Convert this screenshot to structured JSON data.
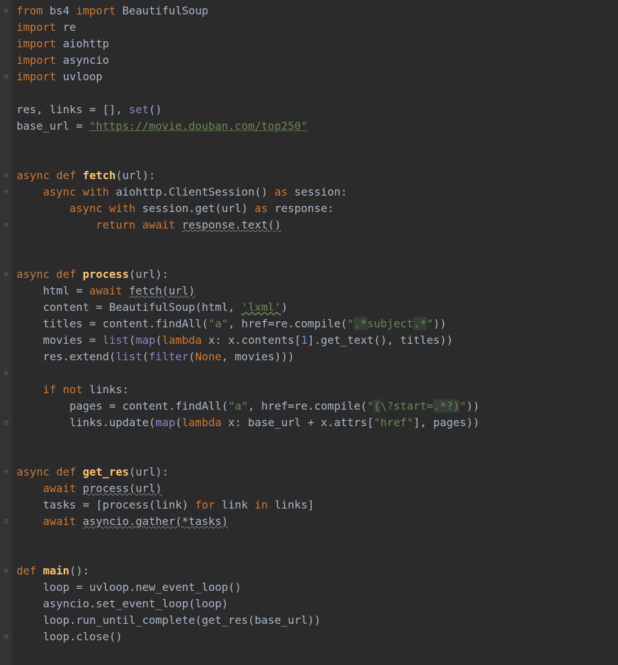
{
  "code": {
    "lines": [
      {
        "tokens": [
          {
            "t": "from ",
            "c": "kw"
          },
          {
            "t": "bs4 ",
            "c": "id"
          },
          {
            "t": "import ",
            "c": "kw"
          },
          {
            "t": "BeautifulSoup",
            "c": "id"
          }
        ],
        "gutter": "⊖"
      },
      {
        "tokens": [
          {
            "t": "import ",
            "c": "kw"
          },
          {
            "t": "re",
            "c": "id"
          }
        ],
        "gutter": ""
      },
      {
        "tokens": [
          {
            "t": "import ",
            "c": "kw"
          },
          {
            "t": "aiohttp",
            "c": "id"
          }
        ],
        "gutter": ""
      },
      {
        "tokens": [
          {
            "t": "import ",
            "c": "kw"
          },
          {
            "t": "asyncio",
            "c": "id"
          }
        ],
        "gutter": ""
      },
      {
        "tokens": [
          {
            "t": "import ",
            "c": "kw"
          },
          {
            "t": "uvloop",
            "c": "id"
          }
        ],
        "gutter": "⊟"
      },
      {
        "tokens": [
          {
            "t": "",
            "c": "id"
          }
        ],
        "gutter": ""
      },
      {
        "tokens": [
          {
            "t": "res, links = [], ",
            "c": "id"
          },
          {
            "t": "set",
            "c": "builtin"
          },
          {
            "t": "()",
            "c": "id"
          }
        ],
        "gutter": ""
      },
      {
        "tokens": [
          {
            "t": "base_url = ",
            "c": "id"
          },
          {
            "t": "\"https://movie.douban.com/top250\"",
            "c": "strhref"
          }
        ],
        "gutter": ""
      },
      {
        "tokens": [
          {
            "t": "",
            "c": "id"
          }
        ],
        "gutter": ""
      },
      {
        "tokens": [
          {
            "t": "",
            "c": "id"
          }
        ],
        "gutter": ""
      },
      {
        "tokens": [
          {
            "t": "async def ",
            "c": "kw"
          },
          {
            "t": "fetch",
            "c": "fn"
          },
          {
            "t": "(url):",
            "c": "id"
          }
        ],
        "gutter": "⊖"
      },
      {
        "tokens": [
          {
            "t": "    ",
            "c": "id"
          },
          {
            "t": "async with ",
            "c": "kw"
          },
          {
            "t": "aiohttp.ClientSession() ",
            "c": "id"
          },
          {
            "t": "as ",
            "c": "kw"
          },
          {
            "t": "session:",
            "c": "id"
          }
        ],
        "gutter": "⊖"
      },
      {
        "tokens": [
          {
            "t": "        ",
            "c": "id"
          },
          {
            "t": "async with ",
            "c": "kw"
          },
          {
            "t": "session.get(url) ",
            "c": "id"
          },
          {
            "t": "as ",
            "c": "kw"
          },
          {
            "t": "response:",
            "c": "id"
          }
        ],
        "gutter": ""
      },
      {
        "tokens": [
          {
            "t": "            ",
            "c": "id"
          },
          {
            "t": "return await ",
            "c": "kw"
          },
          {
            "t": "response.text()",
            "c": "id wavy"
          }
        ],
        "gutter": "⊟"
      },
      {
        "tokens": [
          {
            "t": "",
            "c": "id"
          }
        ],
        "gutter": ""
      },
      {
        "tokens": [
          {
            "t": "",
            "c": "id"
          }
        ],
        "gutter": ""
      },
      {
        "tokens": [
          {
            "t": "async def ",
            "c": "kw"
          },
          {
            "t": "process",
            "c": "fn"
          },
          {
            "t": "(url):",
            "c": "id"
          }
        ],
        "gutter": "⊖"
      },
      {
        "tokens": [
          {
            "t": "    html = ",
            "c": "id"
          },
          {
            "t": "await ",
            "c": "kw"
          },
          {
            "t": "fetch(url)",
            "c": "id wavy"
          }
        ],
        "gutter": ""
      },
      {
        "tokens": [
          {
            "t": "    content = BeautifulSoup(html, ",
            "c": "id"
          },
          {
            "t": "'lxml'",
            "c": "str wavyg"
          },
          {
            "t": ")",
            "c": "id"
          }
        ],
        "gutter": ""
      },
      {
        "tokens": [
          {
            "t": "    titles = content.findAll(",
            "c": "id"
          },
          {
            "t": "\"a\"",
            "c": "str"
          },
          {
            "t": ", ",
            "c": "id"
          },
          {
            "t": "href",
            "c": "id"
          },
          {
            "t": "=re.compile(",
            "c": "id"
          },
          {
            "t": "\"",
            "c": "str"
          },
          {
            "t": ".*",
            "c": "str hl"
          },
          {
            "t": "subject",
            "c": "str"
          },
          {
            "t": ".*",
            "c": "str hl"
          },
          {
            "t": "\"",
            "c": "str"
          },
          {
            "t": "))",
            "c": "id"
          }
        ],
        "gutter": ""
      },
      {
        "tokens": [
          {
            "t": "    movies = ",
            "c": "id"
          },
          {
            "t": "list",
            "c": "builtin"
          },
          {
            "t": "(",
            "c": "id"
          },
          {
            "t": "map",
            "c": "builtin"
          },
          {
            "t": "(",
            "c": "id"
          },
          {
            "t": "lambda ",
            "c": "kw"
          },
          {
            "t": "x: x.contents[",
            "c": "id"
          },
          {
            "t": "1",
            "c": "num"
          },
          {
            "t": "].get_text(), titles))",
            "c": "id"
          }
        ],
        "gutter": ""
      },
      {
        "tokens": [
          {
            "t": "    res.extend(",
            "c": "id"
          },
          {
            "t": "list",
            "c": "builtin"
          },
          {
            "t": "(",
            "c": "id"
          },
          {
            "t": "filter",
            "c": "builtin"
          },
          {
            "t": "(",
            "c": "id"
          },
          {
            "t": "None",
            "c": "kw"
          },
          {
            "t": ", movies)))",
            "c": "id"
          }
        ],
        "gutter": ""
      },
      {
        "tokens": [
          {
            "t": "",
            "c": "id"
          }
        ],
        "gutter": "⊖"
      },
      {
        "tokens": [
          {
            "t": "    ",
            "c": "id"
          },
          {
            "t": "if not ",
            "c": "kw"
          },
          {
            "t": "links:",
            "c": "id"
          }
        ],
        "gutter": ""
      },
      {
        "tokens": [
          {
            "t": "        pages = content.findAll(",
            "c": "id"
          },
          {
            "t": "\"a\"",
            "c": "str"
          },
          {
            "t": ", ",
            "c": "id"
          },
          {
            "t": "href",
            "c": "id"
          },
          {
            "t": "=re.compile(",
            "c": "id"
          },
          {
            "t": "\"",
            "c": "str"
          },
          {
            "t": "(",
            "c": "str hl"
          },
          {
            "t": "\\?start=",
            "c": "str"
          },
          {
            "t": ".*?)",
            "c": "str hl"
          },
          {
            "t": "\"",
            "c": "str"
          },
          {
            "t": "))",
            "c": "id"
          }
        ],
        "gutter": ""
      },
      {
        "tokens": [
          {
            "t": "        links.update(",
            "c": "id"
          },
          {
            "t": "map",
            "c": "builtin"
          },
          {
            "t": "(",
            "c": "id"
          },
          {
            "t": "lambda ",
            "c": "kw"
          },
          {
            "t": "x: base_url + x.attrs[",
            "c": "id"
          },
          {
            "t": "\"href\"",
            "c": "str"
          },
          {
            "t": "], pages))",
            "c": "id"
          }
        ],
        "gutter": "⊟"
      },
      {
        "tokens": [
          {
            "t": "",
            "c": "id"
          }
        ],
        "gutter": ""
      },
      {
        "tokens": [
          {
            "t": "",
            "c": "id"
          }
        ],
        "gutter": ""
      },
      {
        "tokens": [
          {
            "t": "async def ",
            "c": "kw"
          },
          {
            "t": "get_res",
            "c": "fn"
          },
          {
            "t": "(url):",
            "c": "id"
          }
        ],
        "gutter": "⊖"
      },
      {
        "tokens": [
          {
            "t": "    ",
            "c": "id"
          },
          {
            "t": "await ",
            "c": "kw"
          },
          {
            "t": "process(url)",
            "c": "id wavy"
          }
        ],
        "gutter": ""
      },
      {
        "tokens": [
          {
            "t": "    tasks = [process(link) ",
            "c": "id"
          },
          {
            "t": "for ",
            "c": "kw"
          },
          {
            "t": "link ",
            "c": "id"
          },
          {
            "t": "in ",
            "c": "kw"
          },
          {
            "t": "links]",
            "c": "id"
          }
        ],
        "gutter": ""
      },
      {
        "tokens": [
          {
            "t": "    ",
            "c": "id"
          },
          {
            "t": "await ",
            "c": "kw"
          },
          {
            "t": "asyncio.gather(*tasks)",
            "c": "id wavy"
          }
        ],
        "gutter": "⊟"
      },
      {
        "tokens": [
          {
            "t": "",
            "c": "id"
          }
        ],
        "gutter": ""
      },
      {
        "tokens": [
          {
            "t": "",
            "c": "id"
          }
        ],
        "gutter": ""
      },
      {
        "tokens": [
          {
            "t": "def ",
            "c": "kw"
          },
          {
            "t": "main",
            "c": "fn"
          },
          {
            "t": "():",
            "c": "id"
          }
        ],
        "gutter": "⊖"
      },
      {
        "tokens": [
          {
            "t": "    loop = uvloop.new_event_loop()",
            "c": "id"
          }
        ],
        "gutter": ""
      },
      {
        "tokens": [
          {
            "t": "    asyncio.set_event_loop(loop)",
            "c": "id"
          }
        ],
        "gutter": ""
      },
      {
        "tokens": [
          {
            "t": "    loop.run_until_complete(get_res(base_url))",
            "c": "id"
          }
        ],
        "gutter": ""
      },
      {
        "tokens": [
          {
            "t": "    loop.close()",
            "c": "id"
          }
        ],
        "gutter": "⊟"
      }
    ]
  }
}
